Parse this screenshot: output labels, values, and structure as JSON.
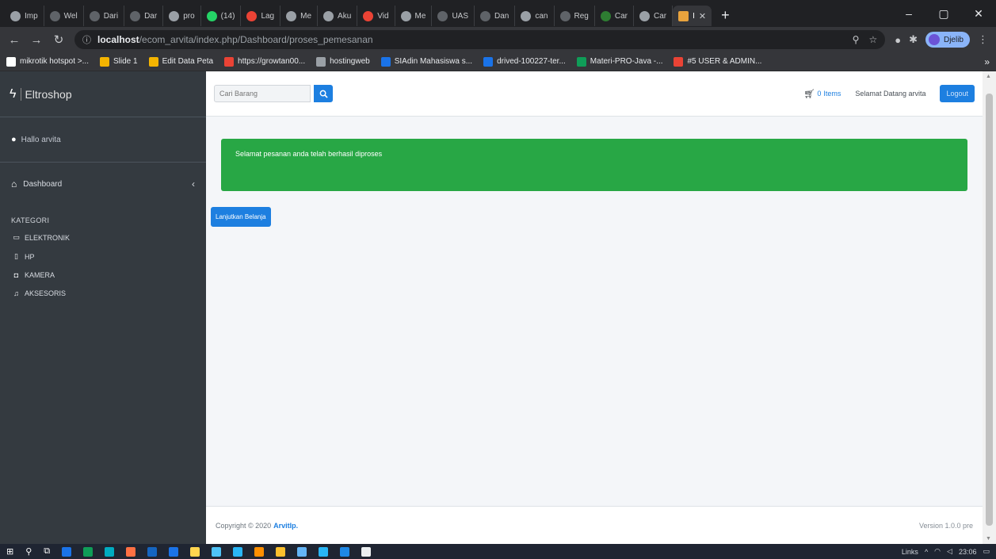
{
  "browser": {
    "tabs": [
      {
        "label": "Imp",
        "color": "#9aa0a6"
      },
      {
        "label": "Wel",
        "color": "#5f6368"
      },
      {
        "label": "Dari",
        "color": "#5f6368"
      },
      {
        "label": "Dar",
        "color": "#5f6368"
      },
      {
        "label": "pro",
        "color": "#9aa0a6"
      },
      {
        "label": "(14)",
        "color": "#25d366"
      },
      {
        "label": "Lag",
        "color": "#ea4335"
      },
      {
        "label": "Me",
        "color": "#9aa0a6"
      },
      {
        "label": "Aku",
        "color": "#9aa0a6"
      },
      {
        "label": "Vid",
        "color": "#ea4335"
      },
      {
        "label": "Me",
        "color": "#9aa0a6"
      },
      {
        "label": "UAS",
        "color": "#5f6368"
      },
      {
        "label": "Dan",
        "color": "#5f6368"
      },
      {
        "label": "can",
        "color": "#9aa0a6"
      },
      {
        "label": "Reg",
        "color": "#5f6368"
      },
      {
        "label": "Car",
        "color": "#2e7d32"
      },
      {
        "label": "Car",
        "color": "#9aa0a6"
      }
    ],
    "active_tab": {
      "label": "I"
    },
    "new_tab": "+",
    "win_controls": {
      "minimize": "–",
      "maximize": "▢",
      "close": "✕"
    },
    "address": {
      "host": "localhost",
      "path": "/ecom_arvita/index.php/Dashboard/proses_pemesanan"
    },
    "profile_label": "Djelib",
    "bookmarks": [
      {
        "label": "mikrotik hotspot >...",
        "color": "#ffffff"
      },
      {
        "label": "Slide 1",
        "color": "#f4b400"
      },
      {
        "label": "Edit Data Peta",
        "color": "#f4b400"
      },
      {
        "label": "https://growtan00...",
        "color": "#ea4335"
      },
      {
        "label": "hostingweb",
        "color": "#9aa0a6"
      },
      {
        "label": "SIAdin Mahasiswa s...",
        "color": "#1a73e8"
      },
      {
        "label": "drived-100227-ter...",
        "color": "#1a73e8"
      },
      {
        "label": "Materi-PRO-Java -...",
        "color": "#0f9d58"
      },
      {
        "label": "#5 USER & ADMIN...",
        "color": "#ea4335"
      }
    ],
    "bookmarks_more": "»"
  },
  "sidebar": {
    "brand": "Eltroshop",
    "user": "Hallo arvita",
    "dashboard": "Dashboard",
    "category_header": "KATEGORI",
    "categories": [
      {
        "label": "ELEKTRONIK",
        "icon": "monitor-icon",
        "glyph": "▭"
      },
      {
        "label": "HP",
        "icon": "phone-icon",
        "glyph": "▯"
      },
      {
        "label": "KAMERA",
        "icon": "camera-icon",
        "glyph": "◘"
      },
      {
        "label": "AKSESORIS",
        "icon": "headset-icon",
        "glyph": "♫"
      }
    ]
  },
  "topbar": {
    "search_placeholder": "Cari Barang",
    "cart_count": "0",
    "cart_label": "Items",
    "welcome": "Selamat Datang arvita",
    "logout": "Logout"
  },
  "content": {
    "alert": "Selamat pesanan anda telah berhasil diproses",
    "continue_button": "Lanjutkan Belanja"
  },
  "footer": {
    "copyright": "Copyright © 2020",
    "author": "ArvitIp.",
    "version": "Version 1.0.0 pre"
  },
  "taskbar": {
    "apps": [
      "#1a73e8",
      "#0f9d58",
      "#00acc1",
      "#ff7043",
      "#1565c0",
      "#1a73e8",
      "#ffd54f",
      "#4fc3f7",
      "#29b6f6",
      "#ff8f00",
      "#fbc02d",
      "#64b5f6",
      "#29b6f6",
      "#1e88e5",
      "#eceff1"
    ],
    "tray_text": "Links",
    "clock": "23:06"
  },
  "colors": {
    "primary": "#1d7fe0",
    "success": "#28a745",
    "sidebar": "#343a40"
  }
}
